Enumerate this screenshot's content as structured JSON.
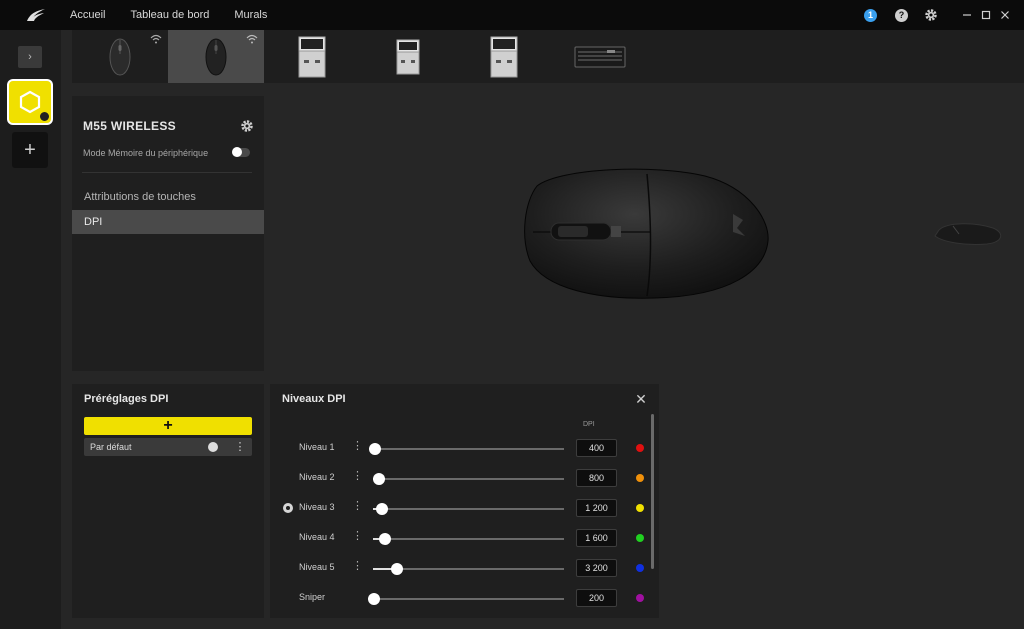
{
  "nav": {
    "home": "Accueil",
    "dashboard": "Tableau de bord",
    "murals": "Murals"
  },
  "notifications": {
    "count": "1"
  },
  "help": {
    "label": "?"
  },
  "rail": {
    "toggle_glyph": "›",
    "add_glyph": "+"
  },
  "devices": [
    {
      "name": "mouse-wireless-1",
      "icon": "mouse-icon",
      "wireless": true,
      "selected": false
    },
    {
      "name": "mouse-wireless-2",
      "icon": "mouse-icon",
      "wireless": true,
      "selected": true
    },
    {
      "name": "usb-receiver-1",
      "icon": "usb-receiver-icon",
      "wireless": false,
      "selected": false
    },
    {
      "name": "usb-receiver-2",
      "icon": "usb-receiver-icon",
      "wireless": false,
      "selected": false
    },
    {
      "name": "usb-receiver-3",
      "icon": "usb-receiver-icon",
      "wireless": false,
      "selected": false
    },
    {
      "name": "keyboard",
      "icon": "keyboard-icon",
      "wireless": false,
      "selected": false
    }
  ],
  "device_panel": {
    "name": "M55 WIRELESS",
    "memory_mode_label": "Mode Mémoire du périphérique",
    "memory_mode_on": false,
    "menu": [
      {
        "label": "Attributions de touches",
        "active": false
      },
      {
        "label": "DPI",
        "active": true
      }
    ]
  },
  "presets": {
    "title": "Préréglages DPI",
    "add_glyph": "+",
    "items": [
      {
        "label": "Par défaut",
        "menu": "⋮"
      }
    ]
  },
  "dpi_levels": {
    "title": "Niveaux DPI",
    "close_glyph": "✕",
    "column_header": "DPI",
    "levels": [
      {
        "label": "Niveau 1",
        "value": "400",
        "fraction": 0.01,
        "color": "#e01010",
        "active": false,
        "menu": "⋮"
      },
      {
        "label": "Niveau 2",
        "value": "800",
        "fraction": 0.03,
        "color": "#f0900a",
        "active": false,
        "menu": "⋮"
      },
      {
        "label": "Niveau 3",
        "value": "1 200",
        "fraction": 0.045,
        "color": "#f0e000",
        "active": true,
        "menu": "⋮"
      },
      {
        "label": "Niveau 4",
        "value": "1 600",
        "fraction": 0.065,
        "color": "#20d020",
        "active": false,
        "menu": "⋮"
      },
      {
        "label": "Niveau 5",
        "value": "3 200",
        "fraction": 0.125,
        "color": "#1030e0",
        "active": false,
        "menu": "⋮"
      },
      {
        "label": "Sniper",
        "value": "200",
        "fraction": 0.005,
        "color": "#a010a0",
        "active": false,
        "menu": ""
      }
    ]
  }
}
